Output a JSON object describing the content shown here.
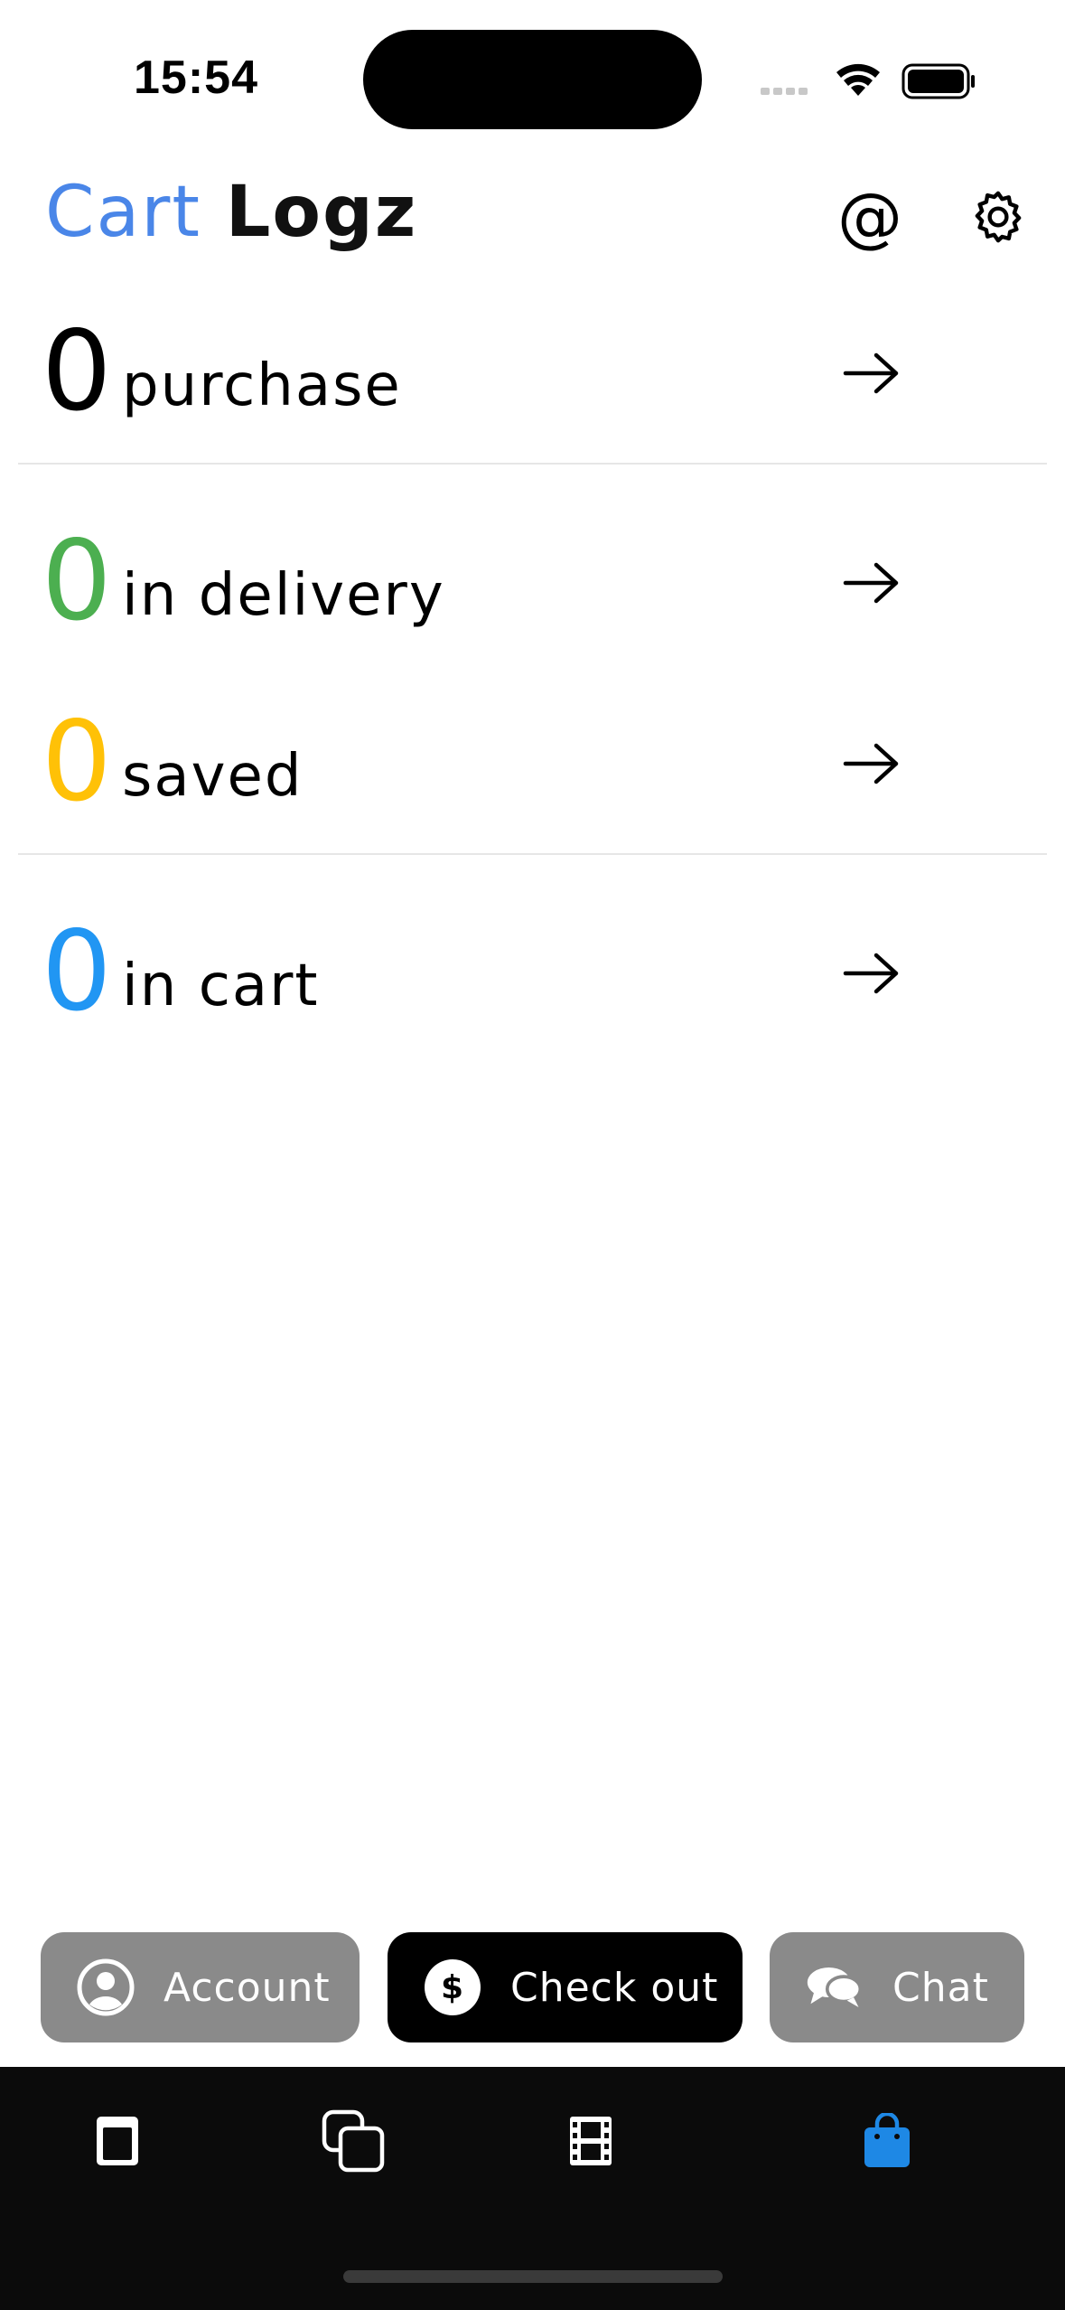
{
  "status_bar": {
    "time": "15:54"
  },
  "header": {
    "title_part1": "Cart",
    "title_part2": "Logz",
    "title_part1_color": "#4A86E8",
    "title_part2_color": "#111111",
    "at_symbol": "@"
  },
  "stats": [
    {
      "count": "0",
      "label": "purchase",
      "color": "#000000"
    },
    {
      "count": "0",
      "label": "in delivery",
      "color": "#4CAF50"
    },
    {
      "count": "0",
      "label": "saved",
      "color": "#FFC107"
    },
    {
      "count": "0",
      "label": "in cart",
      "color": "#2196F3"
    }
  ],
  "actions": {
    "account_label": "Account",
    "checkout_label": "Check out",
    "checkout_icon_glyph": "$",
    "chat_label": "Chat"
  },
  "tab_bar": {
    "tabs": [
      {
        "icon": "document-icon",
        "active": false
      },
      {
        "icon": "overlapping-squares-icon",
        "active": false
      },
      {
        "icon": "film-icon",
        "active": false
      },
      {
        "icon": "shopping-bag-icon",
        "active": true
      }
    ],
    "active_color": "#1E88E5",
    "inactive_color": "#FFFFFF"
  }
}
